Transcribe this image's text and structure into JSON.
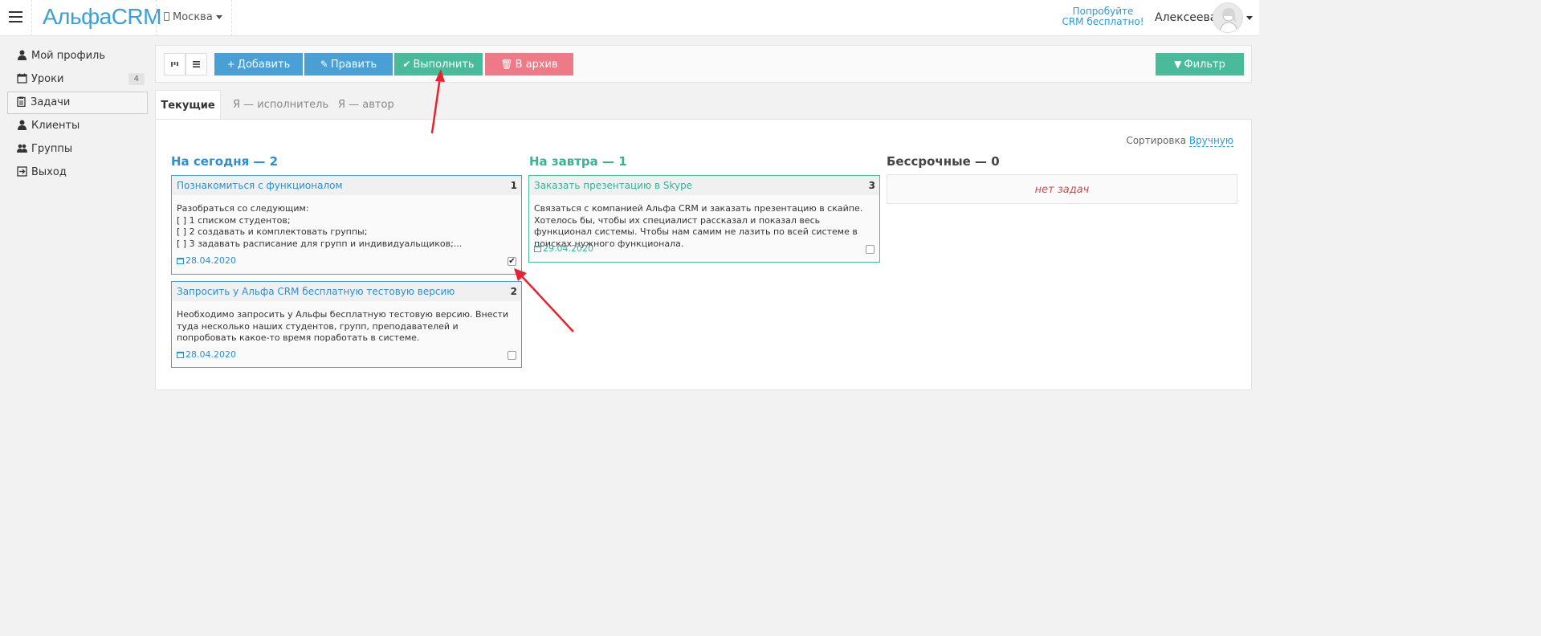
{
  "header": {
    "logo": "АльфаCRM",
    "city": "Москва",
    "try_line1": "Попробуйте",
    "try_line2": "CRM бесплатно!",
    "username": "Алексеева"
  },
  "sidebar": {
    "items": [
      {
        "label": "Мой профиль",
        "icon": "user-icon"
      },
      {
        "label": "Уроки",
        "icon": "calendar-icon",
        "badge": "4"
      },
      {
        "label": "Задачи",
        "icon": "clipboard-icon",
        "active": true
      },
      {
        "label": "Клиенты",
        "icon": "user-icon"
      },
      {
        "label": "Группы",
        "icon": "users-icon"
      },
      {
        "label": "Выход",
        "icon": "logout-icon"
      }
    ]
  },
  "toolbar": {
    "add": "Добавить",
    "edit": "Править",
    "done": "Выполнить",
    "archive": "В архив",
    "filter": "Фильтр"
  },
  "tabs": [
    "Текущие",
    "Я — исполнитель",
    "Я — автор"
  ],
  "sort": {
    "label": "Сортировка",
    "value": "Вручную"
  },
  "columns": [
    {
      "title": "На сегодня — 2",
      "color": "#2b8fd0",
      "cards": [
        {
          "title": "Познакомиться с функционалом",
          "num": "1",
          "text": "Разобраться со следующим:\n[ ] 1 списком студентов;\n[ ] 2 создавать и комплектовать группы;\n[ ] 3 задавать расписание для групп и индивидуальщиков;...",
          "date": "28.04.2020",
          "checked": true
        },
        {
          "title": "Запросить у Альфа CRM бесплатную тестовую версию",
          "num": "2",
          "text": "Необходимо запросить у Альфы бесплатную тестовую версию. Внести туда несколько наших студентов, групп, преподавателей и попробовать какое-то время поработать в системе.",
          "date": "28.04.2020",
          "checked": false
        }
      ]
    },
    {
      "title": "На завтра — 1",
      "color": "#36b295",
      "cards": [
        {
          "title": "Заказать презентацию в Skype",
          "num": "3",
          "text": "Связаться с компанией Альфа CRM и заказать презентацию в скайпе. Хотелось бы, чтобы их специалист рассказал и показал весь функционал системы. Чтобы нам самим не лазить по всей системе в поисках нужного функционала.",
          "date": "29.04.2020",
          "checked": false
        }
      ]
    },
    {
      "title": "Бессрочные — 0",
      "color": "#444444",
      "empty": "нет задач"
    }
  ]
}
